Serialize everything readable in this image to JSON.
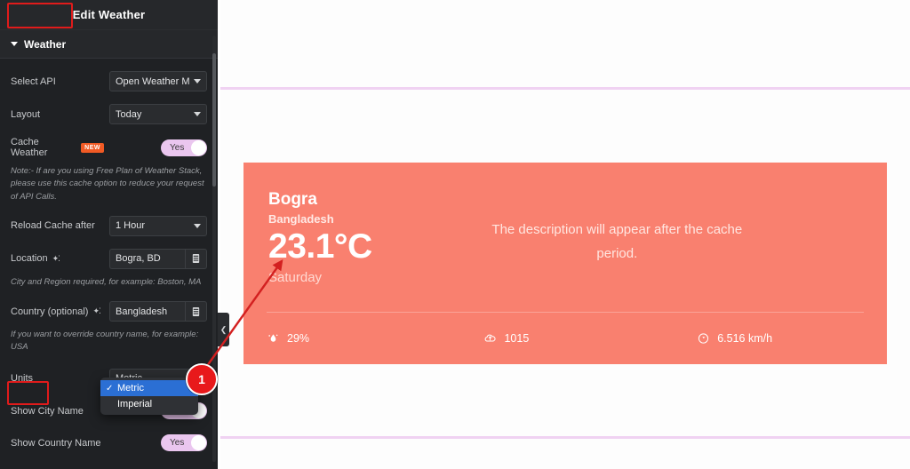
{
  "sidebar": {
    "header_title": "Edit Weather",
    "accordion": {
      "label": "Weather",
      "caret_icon": "caret-down-icon"
    },
    "fields": {
      "select_api": {
        "label": "Select API",
        "value": "Open Weather Map"
      },
      "layout": {
        "label": "Layout",
        "value": "Today"
      },
      "cache_weather": {
        "label": "Cache Weather",
        "badge": "NEW",
        "toggle": "Yes"
      },
      "cache_note": "Note:- If are you using Free Plan of Weather Stack, please use this cache option to reduce your request of API Calls.",
      "reload_cache": {
        "label": "Reload Cache after",
        "value": "1 Hour"
      },
      "location": {
        "label": "Location",
        "value": "Bogra, BD",
        "dynamic_icon": "dynamic-tags-icon",
        "db_icon": "database-icon"
      },
      "location_note": "City and Region required, for example: Boston, MA",
      "country": {
        "label": "Country (optional)",
        "value": "Bangladesh",
        "dynamic_icon": "dynamic-tags-icon",
        "db_icon": "database-icon"
      },
      "country_note": "If you want to override country name, for example: USA",
      "units": {
        "label": "Units",
        "value": "Metric",
        "options": [
          "Metric",
          "Imperial"
        ],
        "selected_index": 0
      },
      "show_city_name": {
        "label": "Show City Name",
        "toggle": "Yes"
      },
      "show_country_name": {
        "label": "Show Country Name",
        "toggle": "Yes"
      }
    }
  },
  "canvas": {
    "collapse_handle_icon": "chevron-left-icon",
    "weather_card": {
      "city": "Bogra",
      "country": "Bangladesh",
      "temperature": "23.1°C",
      "day": "Saturday",
      "description": "The description will appear after the cache period.",
      "humidity": {
        "icon": "humidity-droplet-icon",
        "value": "29%"
      },
      "pressure": {
        "icon": "cloud-pressure-icon",
        "value": "1015"
      },
      "wind": {
        "icon": "wind-speed-icon",
        "value": "6.516 km/h"
      }
    }
  },
  "annotation": {
    "step_badge": "1",
    "arrow_icon": "arrow-pointer-icon",
    "highlight_boxes": [
      "Weather",
      "Units"
    ]
  },
  "colors": {
    "accent_red": "#e8191b",
    "card_bg": "#f9806f",
    "toggle_on": "#eac6ef",
    "new_badge": "#f15a24",
    "dropdown_selected": "#2b6fd4",
    "guide_line": "#f0d2f2"
  }
}
